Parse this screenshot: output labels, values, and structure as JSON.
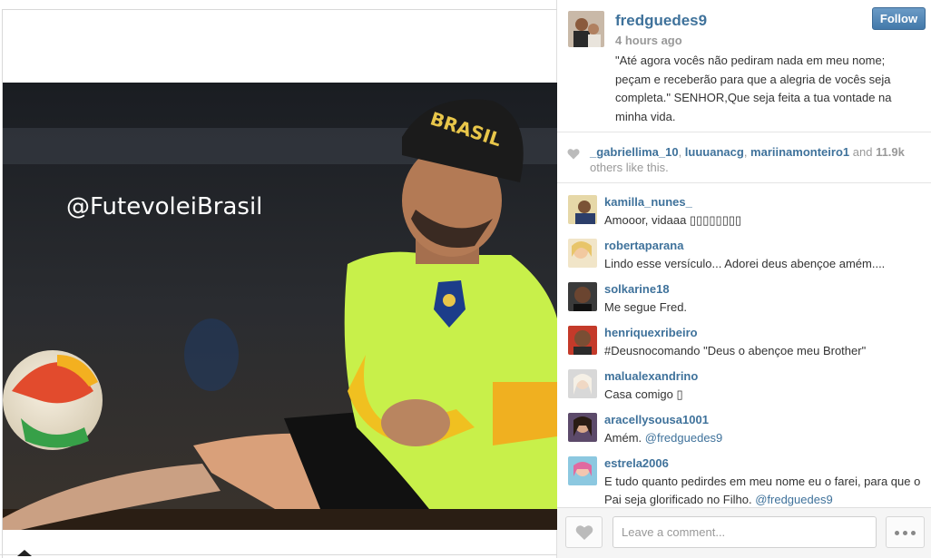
{
  "post": {
    "watermark": "@FutevoleiBrasil",
    "photo_description_icon": "soccer-player-photo",
    "beanie_text": "BRASIL"
  },
  "owner": {
    "username": "fredguedes9",
    "time": "4 hours ago",
    "caption": "\"Até agora vocês não pediram nada em meu nome; peçam e receberão para que a alegria de vocês seja completa.\" SENHOR,Que seja feita a tua vontade na minha vida.",
    "follow_label": "Follow"
  },
  "likes": {
    "users": [
      "_gabriellima_10",
      "luuuanacg",
      "mariinamonteiro1"
    ],
    "sep1": ", ",
    "sep2": ", ",
    "and_text": " and ",
    "count": "11.9k",
    "others_text": "others like this."
  },
  "comments": [
    {
      "user": "kamilla_nunes_",
      "text": "Amooor, vidaaa ▯▯▯▯▯▯▯▯",
      "mention": ""
    },
    {
      "user": "robertaparana",
      "text": "Lindo esse versículo... Adorei deus abençoe amém....",
      "mention": ""
    },
    {
      "user": "solkarine18",
      "text": "Me segue Fred.",
      "mention": ""
    },
    {
      "user": "henriquexribeiro",
      "text": "#Deusnocomando \"Deus o abençoe meu Brother\"",
      "mention": ""
    },
    {
      "user": "malualexandrino",
      "text": "Casa comigo ▯",
      "mention": ""
    },
    {
      "user": "aracellysousa1001",
      "text": "Amém. ",
      "mention": "@fredguedes9"
    },
    {
      "user": "estrela2006",
      "text": "E tudo quanto pedirdes em meu nome eu o farei, para que o Pai seja glorificado no Filho. ",
      "mention": "@fredguedes9"
    }
  ],
  "composer": {
    "placeholder": "Leave a comment..."
  },
  "colors": {
    "link": "#3f729b",
    "follow_bg": "#4c82b3",
    "jersey": "#c8f04a"
  }
}
